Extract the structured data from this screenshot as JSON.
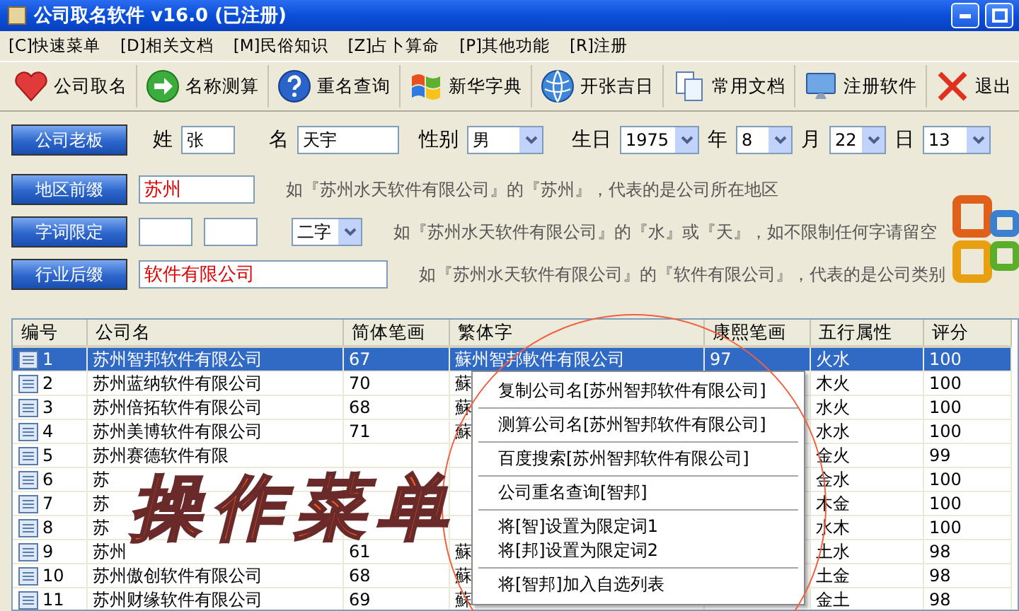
{
  "window": {
    "title": "公司取名软件 v16.0 (已注册)"
  },
  "menu_bar": [
    "[C]快速菜单",
    "[D]相关文档",
    "[M]民俗知识",
    "[Z]占卜算命",
    "[P]其他功能",
    "[R]注册"
  ],
  "toolbar": [
    "公司取名",
    "名称测算",
    "重名查询",
    "新华字典",
    "开张吉日",
    "常用文档",
    "注册软件",
    "退出"
  ],
  "owner": {
    "button": "公司老板",
    "surname_label": "姓",
    "surname": "张",
    "name_label": "名",
    "name": "天宇",
    "gender_label": "性别",
    "gender": "男",
    "birth_label": "生日",
    "year": "1975",
    "year_label": "年",
    "month": "8",
    "month_label": "月",
    "day": "22",
    "day_label": "日",
    "hour": "13"
  },
  "options": [
    {
      "kind": "text",
      "button": "地区前缀",
      "value": "苏州",
      "hint": "如『苏州水天软件有限公司』的『苏州』，代表的是公司所在地区"
    },
    {
      "kind": "pair",
      "button": "字词限定",
      "select": "二字",
      "hint": "如『苏州水天软件有限公司』的『水』或『天』，如不限制任何字请留空"
    },
    {
      "kind": "wide",
      "button": "行业后缀",
      "value": "软件有限公司",
      "hint": "如『苏州水天软件有限公司』的『软件有限公司』，代表的是公司类别"
    }
  ],
  "table": {
    "columns": [
      "编号",
      "公司名",
      "简体笔画",
      "繁体字",
      "康熙笔画",
      "五行属性",
      "评分"
    ],
    "rows": [
      {
        "selected": true,
        "cells": [
          "1",
          "苏州智邦软件有限公司",
          "67",
          "蘇州智邦軟件有限公司",
          "97",
          "火水",
          "100"
        ]
      },
      {
        "selected": false,
        "cells": [
          "2",
          "苏州蓝纳软件有限公司",
          "70",
          "蘇",
          "",
          "木火",
          "100"
        ]
      },
      {
        "selected": false,
        "cells": [
          "3",
          "苏州倍拓软件有限公司",
          "68",
          "蘇",
          "",
          "水火",
          "100"
        ]
      },
      {
        "selected": false,
        "cells": [
          "4",
          "苏州美博软件有限公司",
          "71",
          "蘇",
          "",
          "水水",
          "100"
        ]
      },
      {
        "selected": false,
        "cells": [
          "5",
          "苏州赛德软件有限",
          "",
          "",
          "",
          "金火",
          "99"
        ]
      },
      {
        "selected": false,
        "cells": [
          "6",
          "苏",
          "",
          "",
          "",
          "金水",
          "100"
        ]
      },
      {
        "selected": false,
        "cells": [
          "7",
          "苏",
          "",
          "",
          "",
          "木金",
          "100"
        ]
      },
      {
        "selected": false,
        "cells": [
          "8",
          "苏",
          "",
          "",
          "",
          "水木",
          "100"
        ]
      },
      {
        "selected": false,
        "cells": [
          "9",
          "苏州",
          "61",
          "蘇",
          "",
          "土水",
          "98"
        ]
      },
      {
        "selected": false,
        "cells": [
          "10",
          "苏州傲创软件有限公司",
          "68",
          "蘇",
          "",
          "土金",
          "98"
        ]
      },
      {
        "selected": false,
        "cells": [
          "11",
          "苏州财缘软件有限公司",
          "69",
          "蘇",
          "",
          "金土",
          "98"
        ]
      }
    ]
  },
  "context_menu": {
    "groups": [
      [
        "复制公司名[苏州智邦软件有限公司]"
      ],
      [
        "测算公司名[苏州智邦软件有限公司]"
      ],
      [
        "百度搜索[苏州智邦软件有限公司]"
      ],
      [
        "公司重名查询[智邦]"
      ],
      [
        "将[智]设置为限定词1",
        "将[邦]设置为限定词2"
      ],
      [
        "将[智邦]加入自选列表"
      ]
    ]
  },
  "annotation": {
    "text": "操作菜单"
  }
}
